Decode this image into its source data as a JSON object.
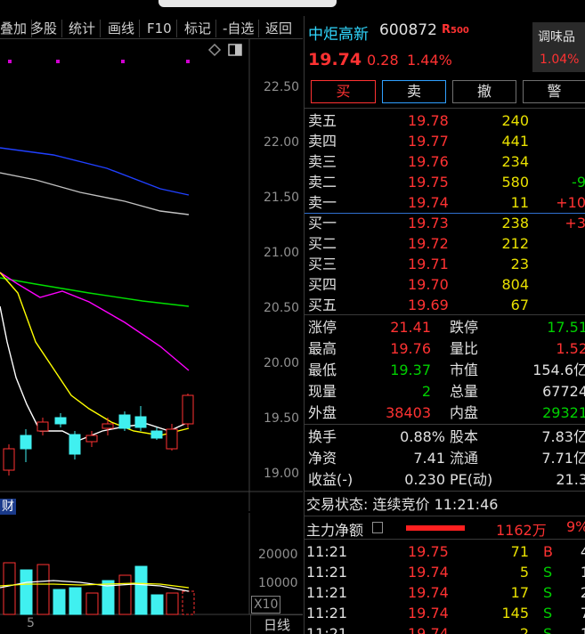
{
  "toolbar": {
    "items": [
      "叠加",
      "多股",
      "统计",
      "画线",
      "F10",
      "标记",
      "-自选",
      "返回"
    ]
  },
  "chart": {
    "price_ticks": [
      "22.50",
      "22.00",
      "21.50",
      "21.00",
      "20.50",
      "20.00",
      "19.50",
      "19.00"
    ],
    "volume_ticks": [
      "20000",
      "10000"
    ],
    "x_label": "5",
    "volume_unit": "X10",
    "period_label": "日线",
    "news_badge": "财",
    "colors": {
      "up": "#ff3232",
      "down": "#40f0f0",
      "ma5": "#ffffff",
      "ma10": "#ffff00",
      "ma20": "#ff00ff",
      "ma30": "#00e000",
      "ma60": "#c0c0c0",
      "ma120": "#2040ff"
    }
  },
  "stock": {
    "name": "中炬高新",
    "code": "600872",
    "tag": "R",
    "tag_sub": "500",
    "price": "19.74",
    "change": "0.28",
    "change_pct": "1.44%",
    "sector_name": "调味品",
    "sector_pct": "1.04%"
  },
  "buttons": {
    "buy": "买",
    "sell": "卖",
    "cancel": "撤",
    "alert": "警"
  },
  "asks": [
    {
      "label": "卖五",
      "price": "19.78",
      "vol": "240",
      "chg": ""
    },
    {
      "label": "卖四",
      "price": "19.77",
      "vol": "441",
      "chg": ""
    },
    {
      "label": "卖三",
      "price": "19.76",
      "vol": "234",
      "chg": ""
    },
    {
      "label": "卖二",
      "price": "19.75",
      "vol": "580",
      "chg": "-9"
    },
    {
      "label": "卖一",
      "price": "19.74",
      "vol": "11",
      "chg": "+10"
    }
  ],
  "bids": [
    {
      "label": "买一",
      "price": "19.73",
      "vol": "238",
      "chg": "+3"
    },
    {
      "label": "买二",
      "price": "19.72",
      "vol": "212",
      "chg": ""
    },
    {
      "label": "买三",
      "price": "19.71",
      "vol": "23",
      "chg": ""
    },
    {
      "label": "买四",
      "price": "19.70",
      "vol": "804",
      "chg": ""
    },
    {
      "label": "买五",
      "price": "19.69",
      "vol": "67",
      "chg": ""
    }
  ],
  "stats1": [
    {
      "l1": "涨停",
      "v1": "21.41",
      "c1": "red",
      "l2": "跌停",
      "v2": "17.51",
      "c2": "green"
    },
    {
      "l1": "最高",
      "v1": "19.76",
      "c1": "red",
      "l2": "量比",
      "v2": "1.52",
      "c2": "red"
    },
    {
      "l1": "最低",
      "v1": "19.37",
      "c1": "green",
      "l2": "市值",
      "v2": "154.6亿",
      "c2": "white"
    },
    {
      "l1": "现量",
      "v1": "2",
      "c1": "green",
      "l2": "总量",
      "v2": "67724",
      "c2": "white"
    },
    {
      "l1": "外盘",
      "v1": "38403",
      "c1": "red",
      "l2": "内盘",
      "v2": "29321",
      "c2": "green"
    }
  ],
  "stats2": [
    {
      "l1": "换手",
      "v1": "0.88%",
      "l2": "股本",
      "v2": "7.83亿"
    },
    {
      "l1": "净资",
      "v1": "7.41",
      "l2": "流通",
      "v2": "7.71亿"
    },
    {
      "l1": "收益(-)",
      "v1": "0.230",
      "l2": "PE(动)",
      "v2": "21.3"
    }
  ],
  "trade_status": "交易状态: 连续竞价 11:21:46",
  "main_flow": {
    "label": "主力净额",
    "value": "1162万",
    "pct": "9%"
  },
  "ticks": [
    {
      "time": "11:21",
      "price": "19.75",
      "vol": "71",
      "side": "B",
      "n": "4"
    },
    {
      "time": "11:21",
      "price": "19.74",
      "vol": "5",
      "side": "S",
      "n": "1"
    },
    {
      "time": "11:21",
      "price": "19.74",
      "vol": "17",
      "side": "S",
      "n": "2"
    },
    {
      "time": "11:21",
      "price": "19.74",
      "vol": "145",
      "side": "S",
      "n": "7"
    },
    {
      "time": "11:21",
      "price": "19.74",
      "vol": "2",
      "side": "S",
      "n": "1"
    }
  ]
}
